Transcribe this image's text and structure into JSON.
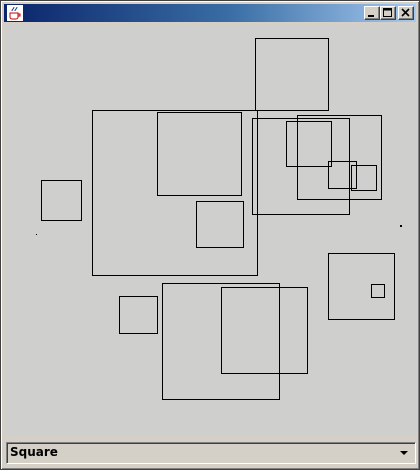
{
  "window": {
    "app_icon": "java-coffee-cup-icon",
    "buttons": [
      "minimize-icon",
      "maximize-icon",
      "close-icon"
    ]
  },
  "shape_selector": {
    "selected": "Square",
    "icon": "dropdown-arrow-icon"
  },
  "colors": {
    "titlebar_start": "#0a246a",
    "titlebar_end": "#a6caf0",
    "canvas": "#cfd0ce",
    "stroke": "#000000"
  }
}
